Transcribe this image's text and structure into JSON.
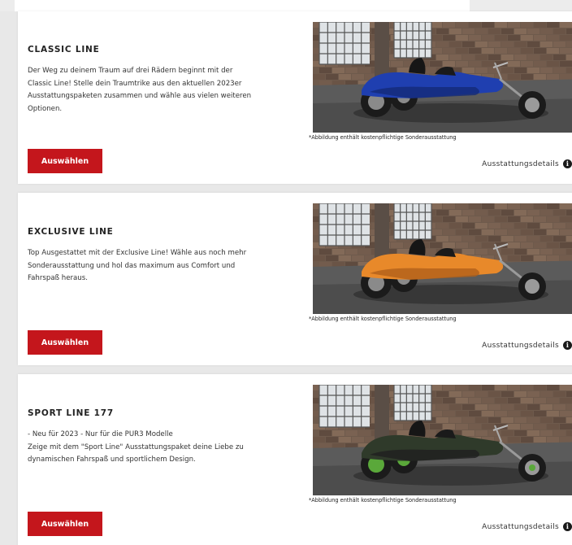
{
  "cards": [
    {
      "title": "CLASSIC LINE",
      "description": "Der Weg zu deinem Traum auf drei Rädern beginnt mit der\nClassic Line! Stelle dein Traumtrike aus den aktuellen 2023er\nAusstattungspaketen zusammen und wähle aus vielen weiteren\nOptionen.",
      "button_label": "Auswählen",
      "image_caption": "*Abbildung enthält kostenpflichtige Sonderausstattung",
      "details_label": "Ausstattungsdetails",
      "trike_color": "#1f3fb0",
      "trike_shade": "#142a78"
    },
    {
      "title": "EXCLUSIVE LINE",
      "description": "Top Ausgestattet mit der Exclusive Line! Wähle aus noch mehr\nSonderausstattung und hol das maximum aus Comfort und\nFahrspaß heraus.",
      "button_label": "Auswählen",
      "image_caption": "*Abbildung enthält kostenpflichtige Sonderausstattung",
      "details_label": "Ausstattungsdetails",
      "trike_color": "#e8892a",
      "trike_shade": "#b0601a"
    },
    {
      "title": "SPORT LINE 177",
      "description": "- Neu für 2023 - Nur für die PUR3 Modelle\nZeige mit dem \"Sport Line\" Ausstattungspaket deine Liebe zu\ndynamischen Fahrspaß und sportlichem Design.",
      "button_label": "Auswählen",
      "image_caption": "*Abbildung enthält kostenpflichtige Sonderausstattung",
      "details_label": "Ausstattungsdetails",
      "trike_color": "#2f3a2a",
      "trike_shade": "#5aa83a"
    }
  ],
  "colors": {
    "accent": "#c4161c",
    "page_bg": "#e8e8e8",
    "card_bg": "#ffffff"
  },
  "icons": {
    "info": "info-icon"
  }
}
